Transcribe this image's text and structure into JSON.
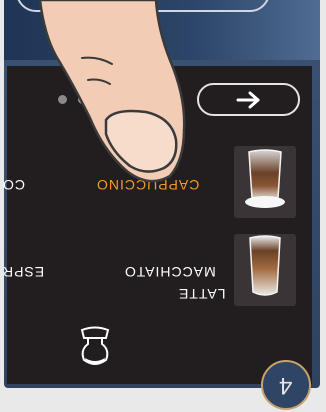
{
  "next_button": {
    "icon": "arrow-right-icon"
  },
  "pager": {
    "pages": 2,
    "active_index": 1
  },
  "menu": {
    "row1_left": "CAPPUCCINO",
    "row1_right_partial": "CO",
    "row2_left_line1": "LATTE",
    "row2_left_line2": "MACCHIATO",
    "row2_right_partial": "ESPR"
  },
  "footer": {
    "icon": "milk-carafe-icon"
  },
  "corner": {
    "glyph": "4"
  },
  "colors": {
    "active": "#f39a2a",
    "text": "#ffffff",
    "screen": "#221d1f",
    "accent": "#c9a36a"
  }
}
